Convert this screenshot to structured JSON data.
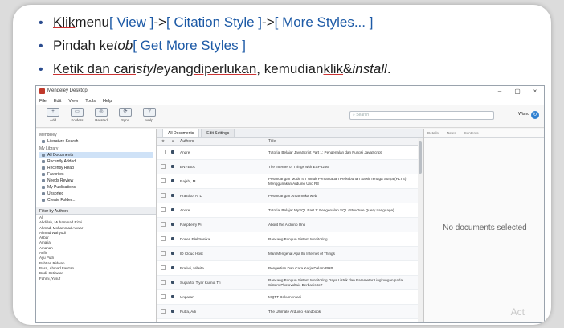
{
  "bullets": [
    {
      "p1": "Klik",
      "p2": " menu ",
      "p3": "[ View ]",
      "p4": " -> ",
      "p5": "[ Citation Style ]",
      "p6": " -> ",
      "p7": "[ More Styles... ]"
    },
    {
      "p1": "Pindah ke",
      "p2": " ",
      "p3": "tob",
      "p4": " ",
      "p5": "[ Get More Styles ]"
    },
    {
      "p1": "Ketik dan cari",
      "p2": " ",
      "p3": "style",
      "p4": " yang ",
      "p5": "diperlukan",
      "p6": ", kemudian ",
      "p7": "klik",
      "p8": " & ",
      "p9": "install",
      "p10": "."
    }
  ],
  "app": {
    "title": "Mendeley Desktop",
    "menu": [
      "File",
      "Edit",
      "View",
      "Tools",
      "Help"
    ],
    "toolbar": [
      {
        "label": "Add",
        "icon": "+"
      },
      {
        "label": "Folders",
        "icon": "▭"
      },
      {
        "label": "Related",
        "icon": "◎"
      },
      {
        "label": "Sync",
        "icon": "⟳"
      },
      {
        "label": "Help",
        "icon": "?"
      }
    ],
    "search_placeholder": "Search",
    "user": "Wisnu",
    "sync_icon": "↻",
    "library": {
      "mendeley_head": "Mendeley",
      "mendeley_items": [
        "Literature Search"
      ],
      "mylib_head": "My Library",
      "mylib_items": [
        "All Documents",
        "Recently Added",
        "Recently Read",
        "Favorites",
        "Needs Review",
        "My Publications",
        "Unsorted",
        "Create Folder..."
      ]
    },
    "filter": {
      "head": "Filter by Authors",
      "items": [
        "All",
        "Abdillah, Muhammad Rizki",
        "Ahmad, Mohammad Anwar",
        "Ahmad Wahyudi",
        "Akbar",
        "Amalia",
        "Amanah",
        "Arifin",
        "Ayu Putri",
        "Bahtiar, Ridwan",
        "Basri, Ahmad Fauzan",
        "Budi, Setiawan",
        "Fahmi, Yusuf"
      ]
    },
    "tabs": [
      "All Documents",
      "Edit Settings"
    ],
    "columns": {
      "authors": "Authors",
      "title": "Title"
    },
    "rows": [
      {
        "author": "Andre",
        "title": "Tutorial Belajar JavaScript Part 1: Pengenalan dan Fungsi JavaScript"
      },
      {
        "author": "ENYESA",
        "title": "The Internet of Things with ESP8266"
      },
      {
        "author": "Rajabi, M.",
        "title": "Perancangan Mode IoT untuk Pemantauan Perkebunan Sawit Tenaga Surya (PLTS) Menggunakan Arduino Uno R3"
      },
      {
        "author": "Prastiko, A. L.",
        "title": "Perancangan Antarmuka web"
      },
      {
        "author": "Andre",
        "title": "Tutorial Belajar MySQL Part 1: Pengenalan SQL (Structure Query Language)"
      },
      {
        "author": "Raspberry Pi",
        "title": "About the Arduino Uno"
      },
      {
        "author": "Dosen Elektronika",
        "title": "Rancang Bangun Sistem Monitoring"
      },
      {
        "author": "ID Cloud Host",
        "title": "Mari Mengenal Apa Itu Internet of Things"
      },
      {
        "author": "Pratiwi, Hilwita",
        "title": "Pengertian Dan Cara Kerja Dalam PHP"
      },
      {
        "author": "Sugiarto, Tiyar Kurnia Tri",
        "title": "Rancang Bangun Sistem Monitoring Daya Listrik dan Parameter Lingkungan pada Sistem Photovoltaic Berbasis IoT"
      },
      {
        "author": "Unparan",
        "title": "MQTT Dokumentasi"
      },
      {
        "author": "Putra, Adi",
        "title": "The Ultimate Arduino Handbook"
      }
    ],
    "right_tabs": [
      "Details",
      "Notes",
      "Contents"
    ],
    "no_docs": "No documents selected",
    "watermark": "Act"
  }
}
